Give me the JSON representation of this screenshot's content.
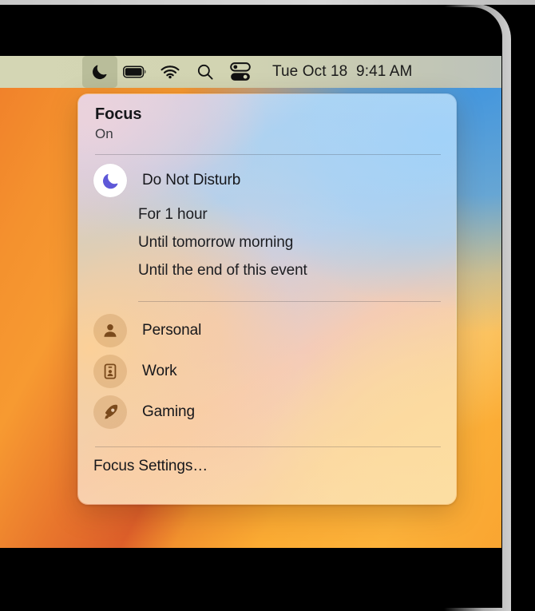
{
  "menubar": {
    "icons": [
      {
        "name": "focus-moon-icon",
        "label": "Focus",
        "active": true
      },
      {
        "name": "battery-icon",
        "label": "Battery",
        "active": false
      },
      {
        "name": "wifi-icon",
        "label": "Wi-Fi",
        "active": false
      },
      {
        "name": "search-icon",
        "label": "Spotlight Search",
        "active": false
      },
      {
        "name": "control-center-icon",
        "label": "Control Center",
        "active": false
      }
    ],
    "clock": "Tue Oct 18  9:41 AM",
    "date_text": "Tue Oct 18",
    "time_text": "9:41 AM"
  },
  "focus_menu": {
    "title": "Focus",
    "state": "On",
    "do_not_disturb": {
      "label": "Do Not Disturb",
      "icon": "moon-icon"
    },
    "timing_options": [
      "For 1 hour",
      "Until tomorrow morning",
      "Until the end of this event"
    ],
    "modes": [
      {
        "label": "Personal",
        "icon": "person-icon"
      },
      {
        "label": "Work",
        "icon": "id-badge-icon"
      },
      {
        "label": "Gaming",
        "icon": "rocket-icon"
      }
    ],
    "settings_label": "Focus Settings…"
  },
  "colors": {
    "menubar_bg": "#d3d5b3",
    "dnd_moon": "#5e58d8",
    "mode_icon_glyph": "#7a4a1c",
    "text_primary": "#16171b",
    "text_secondary": "#3b3c40",
    "wallpaper_orange": "#f79a31",
    "wallpaper_blue": "#4096e1"
  }
}
